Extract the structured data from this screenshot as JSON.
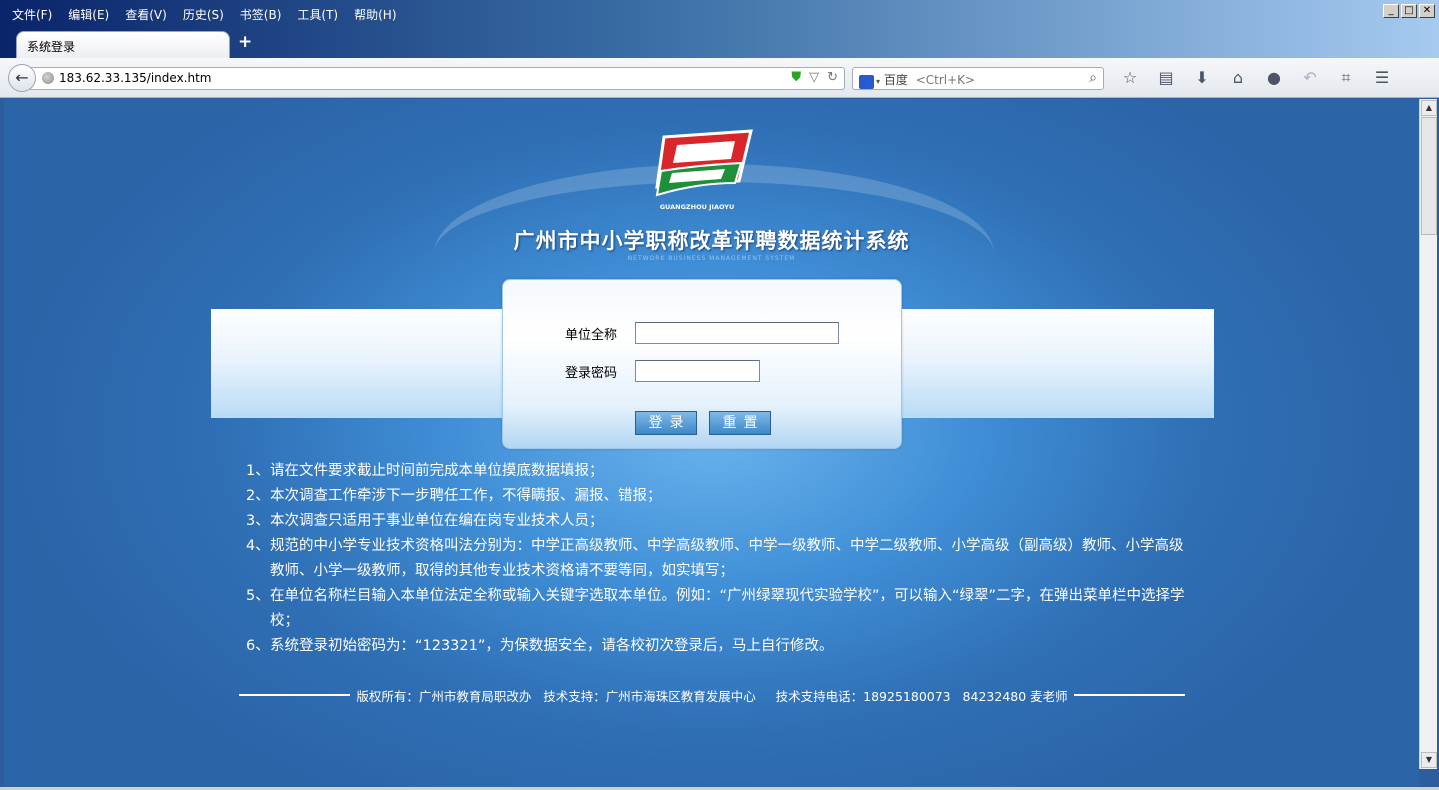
{
  "browser": {
    "menu": [
      "文件(F)",
      "编辑(E)",
      "查看(V)",
      "历史(S)",
      "书签(B)",
      "工具(T)",
      "帮助(H)"
    ],
    "tab_title": "系统登录",
    "new_tab_label": "+",
    "url": "183.62.33.135/index.htm",
    "search_engine": "百度",
    "search_placeholder": "<Ctrl+K>",
    "toolbar_icons": [
      "star-icon",
      "reading-list-icon",
      "download-icon",
      "home-icon",
      "chat-icon",
      "undo-icon",
      "crop-icon",
      "menu-icon"
    ]
  },
  "page": {
    "logo_text": "GUANGZHOU JIAOYU",
    "title": "广州市中小学职称改革评聘数据统计系统",
    "subtitle": "NETWORK  BUSINESS MANAGEMENT SYSTEM",
    "login": {
      "unit_label": "单位全称",
      "password_label": "登录密码",
      "unit_value": "",
      "password_value": "",
      "login_button": "登录",
      "reset_button": "重置"
    },
    "notes": [
      {
        "num": "1、",
        "text": "请在文件要求截止时间前完成本单位摸底数据填报；"
      },
      {
        "num": "2、",
        "text": "本次调查工作牵涉下一步聘任工作，不得瞒报、漏报、错报；"
      },
      {
        "num": "3、",
        "text": "本次调查只适用于事业单位在编在岗专业技术人员；"
      },
      {
        "num": "4、",
        "text": "规范的中小学专业技术资格叫法分别为：中学正高级教师、中学高级教师、中学一级教师、中学二级教师、小学高级（副高级）教师、小学高级教师、小学一级教师，取得的其他专业技术资格请不要等同，如实填写；"
      },
      {
        "num": "5、",
        "text": "在单位名称栏目输入本单位法定全称或输入关键字选取本单位。例如：“广州绿翠现代实验学校”，可以输入“绿翠”二字，在弹出菜单栏中选择学校；"
      },
      {
        "num": "6、",
        "text": "系统登录初始密码为：“123321”，为保数据安全，请各校初次登录后，马上自行修改。"
      }
    ],
    "footer": "版权所有：广州市教育局职改办   技术支持：广州市海珠区教育发展中心     技术支持电话：18925180073   84232480 麦老师"
  }
}
